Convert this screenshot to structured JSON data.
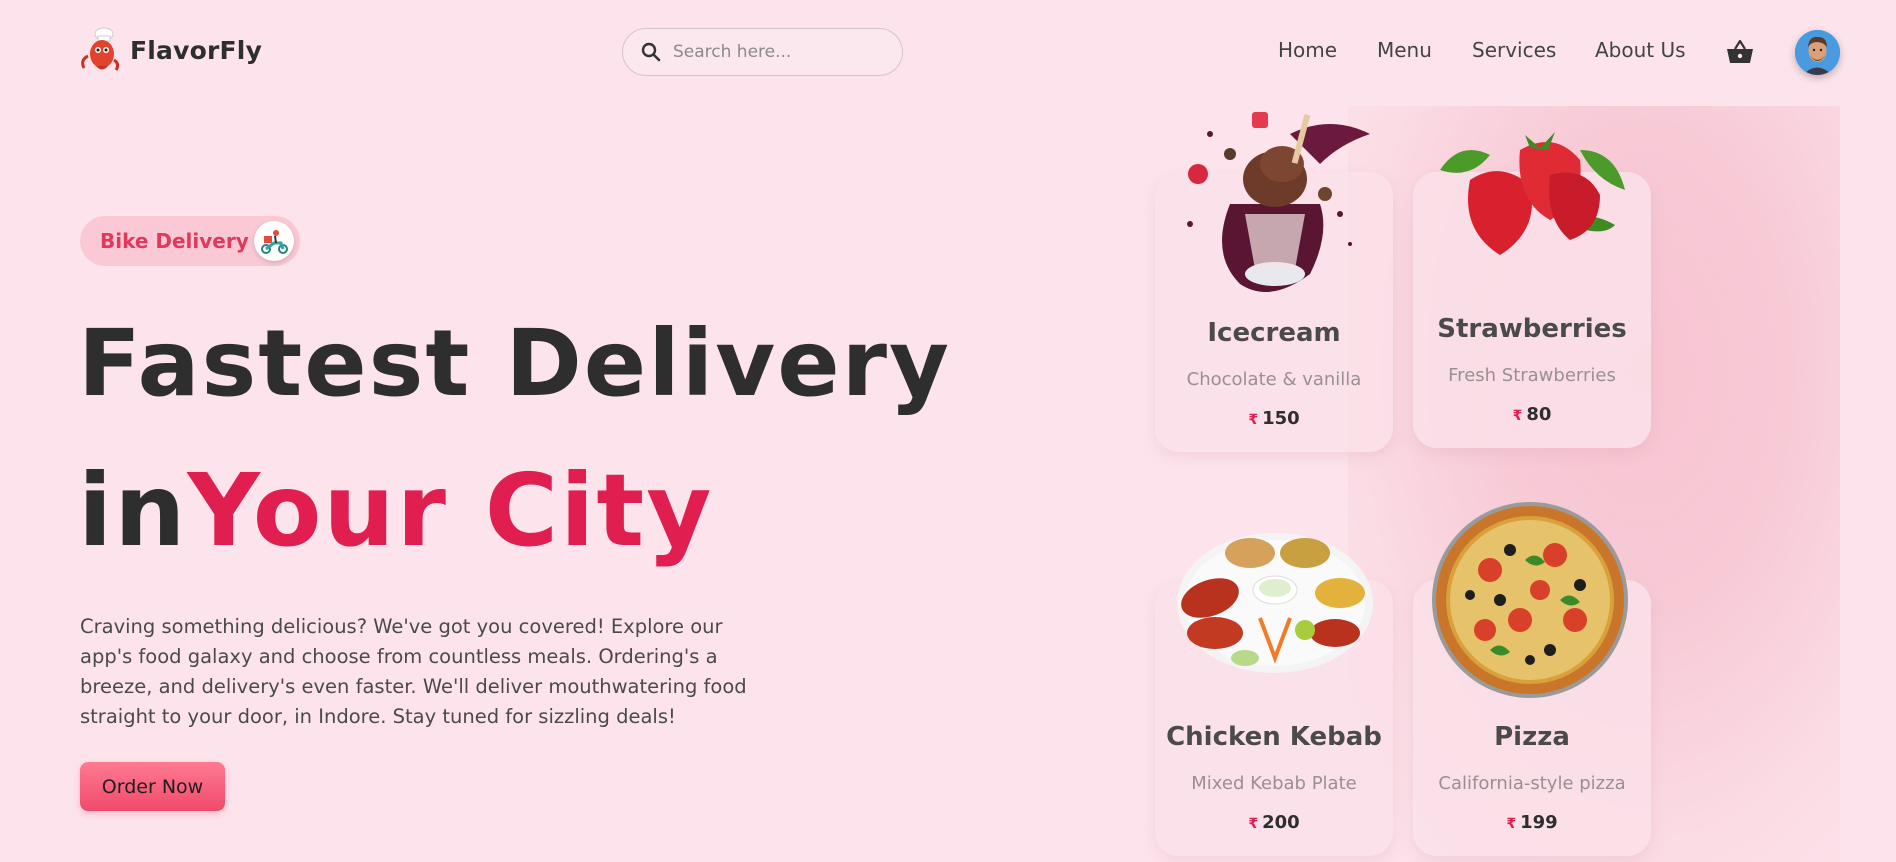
{
  "brand": {
    "name": "FlavorFly"
  },
  "search": {
    "placeholder": "Search here..."
  },
  "nav": {
    "items": [
      "Home",
      "Menu",
      "Services",
      "About Us"
    ]
  },
  "hero": {
    "badge": "Bike Delivery",
    "headline_line1": "Fastest Delivery",
    "headline_in": "in",
    "headline_highlight": "Your City",
    "description": "Craving something delicious? We've got you covered! Explore our app's food galaxy and choose from countless meals. Ordering's a breeze, and delivery's even faster. We'll deliver mouthwatering food straight to your door, in Indore. Stay tuned for sizzling deals!",
    "cta": "Order Now"
  },
  "currency_symbol": "₹",
  "cards": [
    {
      "name": "Icecream",
      "desc": "Chocolate & vanilla",
      "price": "150",
      "icon": "icecream-icon"
    },
    {
      "name": "Strawberries",
      "desc": "Fresh Strawberries",
      "price": "80",
      "icon": "strawberry-icon"
    },
    {
      "name": "Chicken Kebab",
      "desc": "Mixed Kebab Plate",
      "price": "200",
      "icon": "kebab-icon"
    },
    {
      "name": "Pizza",
      "desc": "California-style pizza",
      "price": "199",
      "icon": "pizza-icon"
    }
  ],
  "colors": {
    "accent": "#e01e4f",
    "background": "#fde4ec",
    "button": "#f04a6a",
    "badge": "#fbc9d6"
  }
}
